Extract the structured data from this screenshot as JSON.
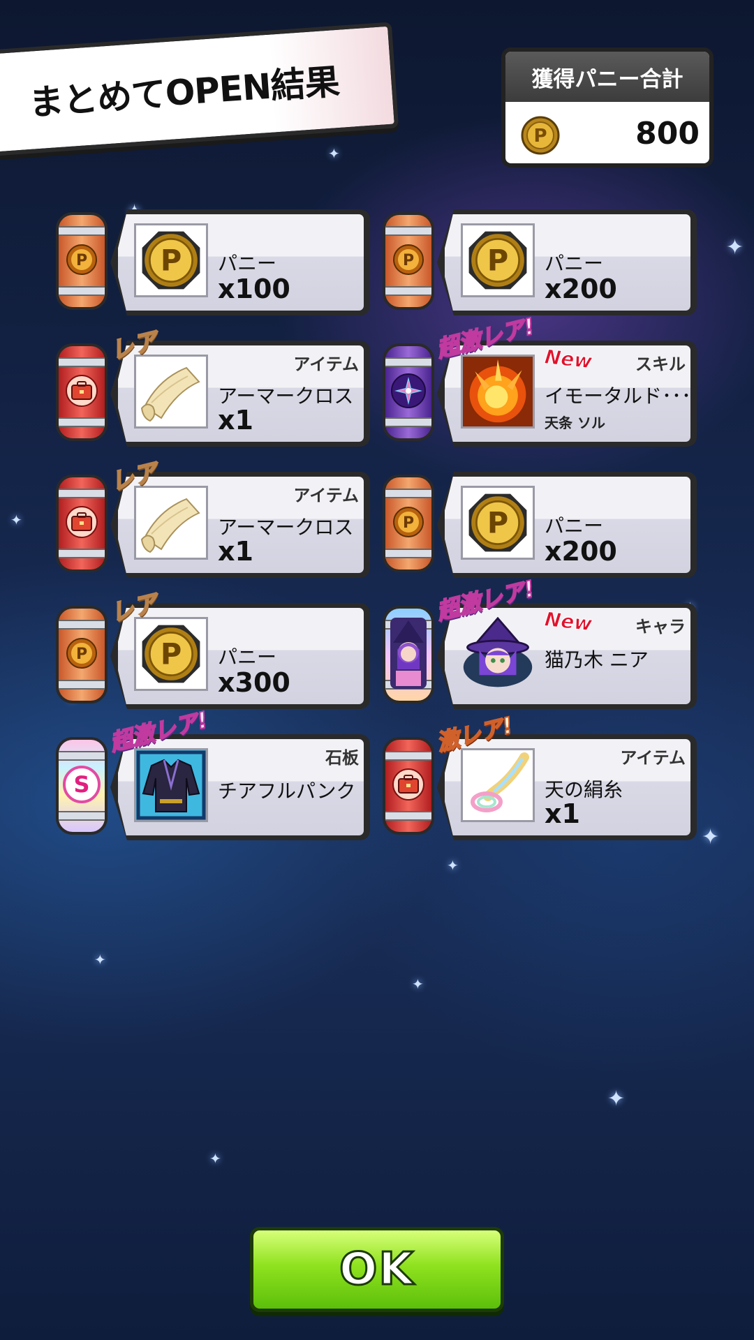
{
  "title": "まとめてOPEN結果",
  "total": {
    "label": "獲得パニー合計",
    "value": "800",
    "icon": "p-coin-icon"
  },
  "rewards": [
    {
      "capsule": "orange",
      "capsule_icon": "p-coin-icon",
      "thumb": "p-coin-icon",
      "rarity": "",
      "is_new": false,
      "category": "",
      "name": "パニー",
      "quantity": "x100",
      "sub": ""
    },
    {
      "capsule": "orange",
      "capsule_icon": "p-coin-icon",
      "thumb": "p-coin-icon",
      "rarity": "",
      "is_new": false,
      "category": "",
      "name": "パニー",
      "quantity": "x200",
      "sub": ""
    },
    {
      "capsule": "red",
      "capsule_icon": "briefcase-icon",
      "thumb": "cloth-scroll-icon",
      "rarity": "レア",
      "is_new": false,
      "category": "アイテム",
      "name": "アーマークロス",
      "quantity": "x1",
      "sub": ""
    },
    {
      "capsule": "purple",
      "capsule_icon": "star-burst-icon",
      "thumb": "explosion-skill-icon",
      "rarity": "超激レア!",
      "is_new": true,
      "category": "スキル",
      "name": "イモータルド･･･",
      "quantity": "",
      "sub": "天条 ソル"
    },
    {
      "capsule": "red",
      "capsule_icon": "briefcase-icon",
      "thumb": "cloth-scroll-icon",
      "rarity": "レア",
      "is_new": false,
      "category": "アイテム",
      "name": "アーマークロス",
      "quantity": "x1",
      "sub": ""
    },
    {
      "capsule": "orange",
      "capsule_icon": "p-coin-icon",
      "thumb": "p-coin-icon",
      "rarity": "",
      "is_new": false,
      "category": "",
      "name": "パニー",
      "quantity": "x200",
      "sub": ""
    },
    {
      "capsule": "orange",
      "capsule_icon": "p-coin-icon",
      "thumb": "p-coin-icon",
      "rarity": "レア",
      "is_new": false,
      "category": "",
      "name": "パニー",
      "quantity": "x300",
      "sub": ""
    },
    {
      "capsule": "character",
      "capsule_icon": "character-portrait-icon",
      "thumb": "witch-girl-icon",
      "rarity": "超激レア!",
      "is_new": true,
      "category": "キャラ",
      "name": "猫乃木 ニア",
      "quantity": "",
      "sub": ""
    },
    {
      "capsule": "rainbow",
      "capsule_icon": "s-letter-icon",
      "thumb": "punk-jacket-icon",
      "rarity": "超激レア!",
      "is_new": false,
      "category": "石板",
      "name": "チアフルパンク",
      "quantity": "",
      "sub": ""
    },
    {
      "capsule": "red",
      "capsule_icon": "briefcase-icon",
      "thumb": "silk-thread-icon",
      "rarity": "激レア!",
      "is_new": false,
      "category": "アイテム",
      "name": "天の絹糸",
      "quantity": "x1",
      "sub": ""
    }
  ],
  "new_label": "New",
  "ok_label": "OK",
  "colors": {
    "ok_button": "#8fe21e",
    "panel": "#f2f2f6",
    "border": "#2a2a2a"
  }
}
